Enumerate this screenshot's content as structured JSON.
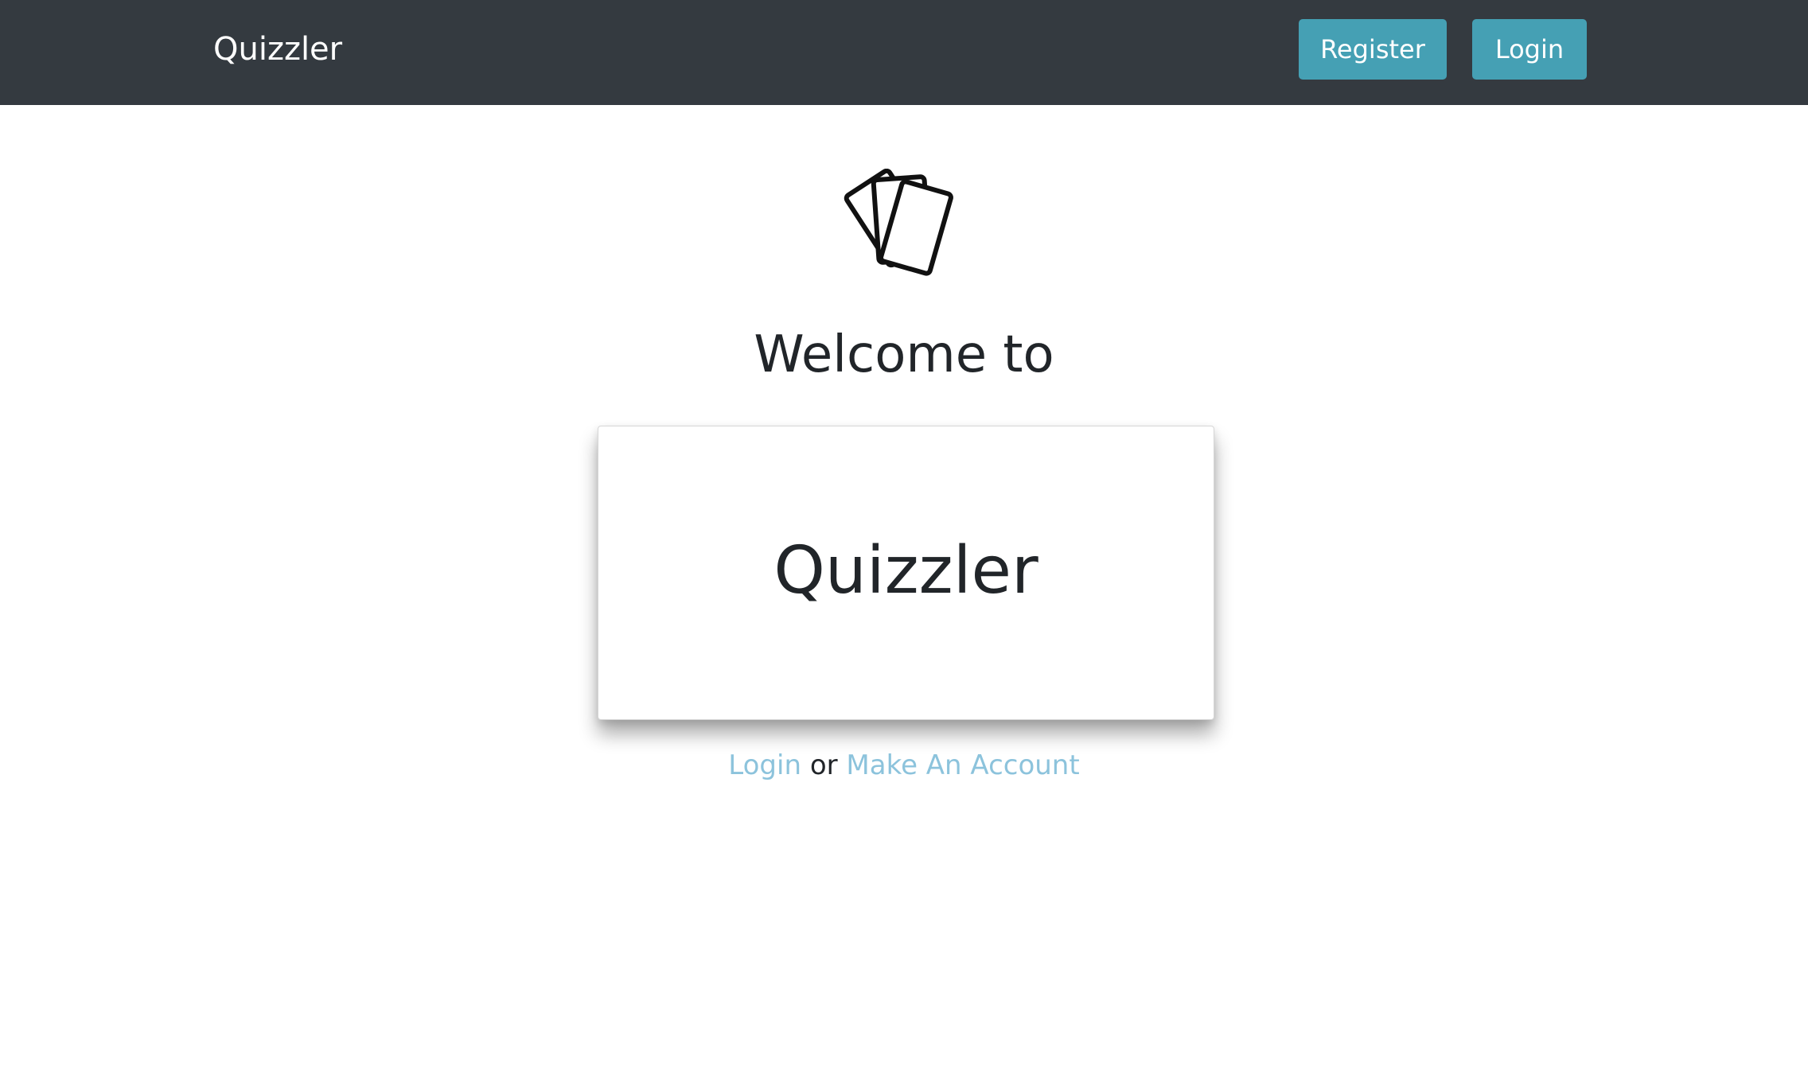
{
  "navbar": {
    "brand": "Quizzler",
    "register_label": "Register",
    "login_label": "Login"
  },
  "main": {
    "icon": "flashcards-icon",
    "welcome_text": "Welcome to",
    "card_title": "Quizzler",
    "links": {
      "login_label": "Login",
      "separator": "or",
      "register_label": "Make An Account"
    }
  },
  "colors": {
    "navbar_bg": "#343a40",
    "button_bg": "#45a0b4",
    "link": "#8cc3dc"
  }
}
